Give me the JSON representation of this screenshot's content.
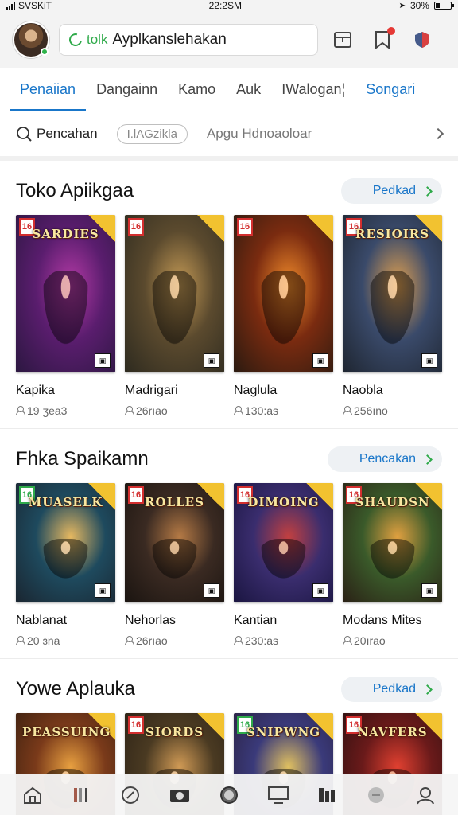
{
  "status_bar": {
    "carrier": "SVSKiT",
    "time": "22:2SM",
    "battery": "30%",
    "battery_level": 0.3
  },
  "header": {
    "search_tag": "tolk",
    "search_value": "Ayplkanslehakan",
    "icons": [
      "avatar",
      "tab-icon",
      "bookmark-icon",
      "shield-icon"
    ],
    "notification_dot": true
  },
  "tabs": [
    {
      "label": "Penaiian",
      "active": true
    },
    {
      "label": "Dangainn",
      "active": false
    },
    {
      "label": "Kamo",
      "active": false
    },
    {
      "label": "Auk",
      "active": false
    },
    {
      "label": "IWalogan¦",
      "active": false
    },
    {
      "label": "Songari",
      "active": false
    }
  ],
  "filters": {
    "chip_1": "Pencahan",
    "chip_2": "I.lAGzikla",
    "chip_3": "Apgu Hdnoaoloar"
  },
  "sections": [
    {
      "title": "Toko Apiikgaa",
      "see_all": "Pedkad",
      "apps": [
        {
          "name": "Kapika",
          "meta": "19 ʒea3",
          "logo": "SARDIES",
          "rating": "16",
          "palette": [
            "#5a1d6e",
            "#b33aa5",
            "#2b1740"
          ]
        },
        {
          "name": "Madrigari",
          "meta": "26rıao",
          "logo": "",
          "rating": "16",
          "palette": [
            "#5b4a2e",
            "#c49a55",
            "#2d2a1f"
          ]
        },
        {
          "name": "Naglula",
          "meta": "130:as",
          "logo": "",
          "rating": "16",
          "palette": [
            "#7a2b10",
            "#f08a2a",
            "#2a1a10"
          ]
        },
        {
          "name": "Naobla",
          "meta": "256ıno",
          "logo": "RESIOIRS",
          "rating": "16",
          "palette": [
            "#3a4a6a",
            "#e0a050",
            "#1e2530"
          ]
        }
      ]
    },
    {
      "title": "Fhka Spaikamn",
      "see_all": "Pencakan",
      "apps": [
        {
          "name": "Nablanat",
          "meta": "20 ɜna",
          "logo": "MUASELK",
          "rating": "16",
          "palette": [
            "#1e4a5e",
            "#e6b860",
            "#1a2530"
          ]
        },
        {
          "name": "Nehorlas",
          "meta": "26rıao",
          "logo": "ROLLES",
          "rating": "16",
          "palette": [
            "#3a2a22",
            "#b57a45",
            "#1a1410"
          ]
        },
        {
          "name": "Kantian",
          "meta": "230:as",
          "logo": "DIMOING",
          "rating": "16",
          "palette": [
            "#3a2d6e",
            "#c24040",
            "#1a1540"
          ]
        },
        {
          "name": "Modans Mites",
          "meta": "20ırao",
          "logo": "SHAUDSN",
          "rating": "16",
          "palette": [
            "#3a5a2a",
            "#e0a040",
            "#2a2015"
          ]
        }
      ]
    },
    {
      "title": "Yowe Aplauka",
      "see_all": "Pedkad",
      "apps": [
        {
          "name": "",
          "meta": "",
          "logo": "PEASSUING",
          "rating": "",
          "palette": [
            "#7a3a1a",
            "#e8a040",
            "#3a2010"
          ]
        },
        {
          "name": "",
          "meta": "",
          "logo": "SIORDS",
          "rating": "16",
          "palette": [
            "#4a3a22",
            "#d09a55",
            "#2a2015"
          ]
        },
        {
          "name": "",
          "meta": "",
          "logo": "SNIPWNG",
          "rating": "16",
          "palette": [
            "#3a3a7a",
            "#e0c060",
            "#2a2040"
          ]
        },
        {
          "name": "",
          "meta": "",
          "logo": "NAVFERS",
          "rating": "16",
          "palette": [
            "#6a1a1a",
            "#e04030",
            "#2a1010"
          ]
        }
      ]
    }
  ],
  "bottom_nav": [
    "home-icon",
    "library-icon",
    "compass-icon",
    "camera-icon",
    "globe-icon",
    "monitor-icon",
    "books-icon",
    "chat-icon",
    "profile-icon"
  ]
}
